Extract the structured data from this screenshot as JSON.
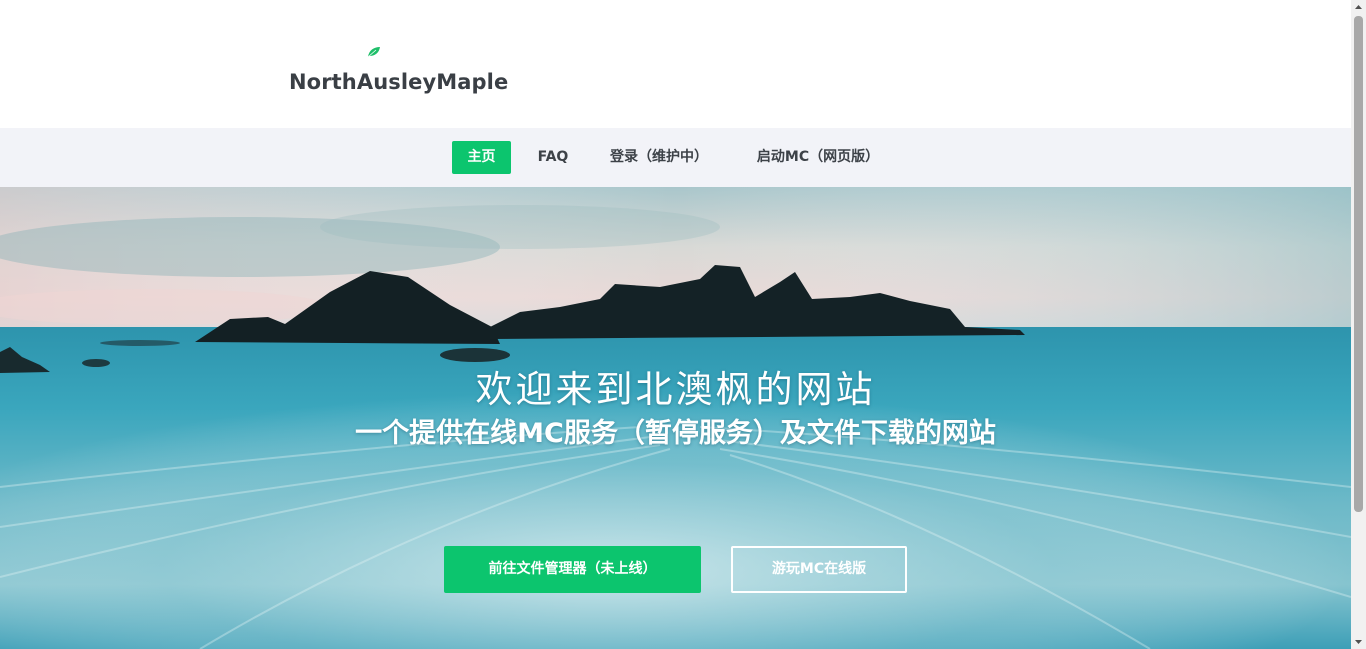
{
  "brand": {
    "name": "NorthAusleyMaple",
    "leaf_color": "#1fbf6a"
  },
  "nav": {
    "items": [
      {
        "label": "主页",
        "active": true
      },
      {
        "label": "FAQ",
        "active": false
      },
      {
        "label": "登录（维护中）",
        "active": false
      },
      {
        "label": "启动MC（网页版）",
        "active": false
      }
    ]
  },
  "hero": {
    "title": "欢迎来到北澳枫的网站",
    "subtitle": "一个提供在线MC服务（暂停服务）及文件下载的网站",
    "primary_button": "前往文件管理器（未上线）",
    "secondary_button": "游玩MC在线版"
  },
  "colors": {
    "accent": "#0cc56e",
    "nav_bg": "#f2f3f8",
    "text": "#3d4248"
  }
}
